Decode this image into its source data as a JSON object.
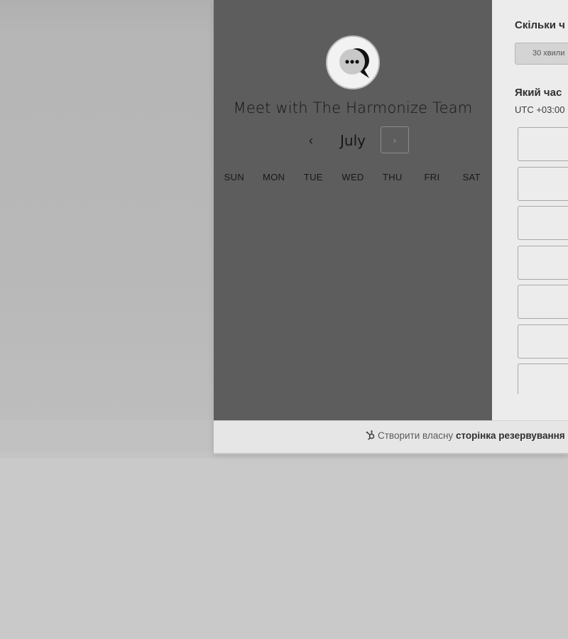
{
  "calendar": {
    "title": "Meet with The Harmonize Team",
    "month": "July",
    "prev_icon": "chevron-left-icon",
    "next_icon": "chevron-right-icon",
    "weekdays": [
      "SUN",
      "MON",
      "TUE",
      "WED",
      "THU",
      "FRI",
      "SAT"
    ]
  },
  "duration": {
    "question": "Скільки ч",
    "selected": "30 хвили"
  },
  "time": {
    "question": "Який час",
    "timezone": "UTC +03:00"
  },
  "footer": {
    "icon": "sprocket-icon",
    "text": "Створити власну",
    "bold": "сторінка резервування"
  },
  "colors": {
    "left_panel": "#5d5d5d",
    "right_panel": "#ececec",
    "backdrop": "#c9c9c9"
  }
}
